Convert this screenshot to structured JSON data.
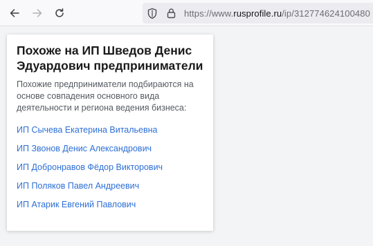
{
  "browser": {
    "url_prefix": "https://www.",
    "url_domain": "rusprofile.ru",
    "url_path": "/ip/312774624100480"
  },
  "card": {
    "title": "Похоже на ИП Шведов Денис Эдуардович предприниматели",
    "description": "Похожие предприниматели подбираются на основе совпадения основного вида деятельности и региона ведения бизнеса:",
    "items": [
      {
        "label": "ИП Сычева Екатерина Витальевна"
      },
      {
        "label": "ИП Звонов Денис Александрович"
      },
      {
        "label": "ИП Добронравов Фёдор Викторович"
      },
      {
        "label": "ИП Поляков Павел Андреевич"
      },
      {
        "label": "ИП Атарик Евгений Павлович"
      }
    ]
  },
  "colors": {
    "link": "#2c6fd6",
    "title": "#1a1a1a",
    "text": "#555a60"
  }
}
